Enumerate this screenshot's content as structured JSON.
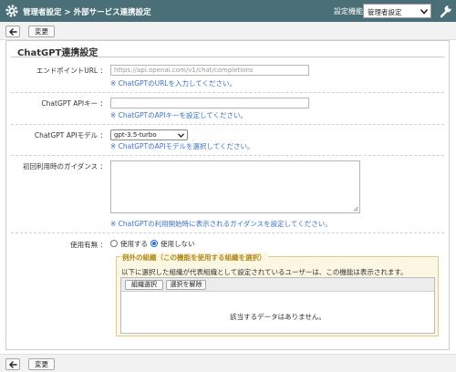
{
  "header": {
    "breadcrumb_root": "管理者設定",
    "breadcrumb_sep": ">",
    "breadcrumb_current": "外部サービス連携設定",
    "function_label": "設定機能：",
    "function_value": "管理者設定",
    "colors": {
      "header_bg": "#4a6f76",
      "header_text": "#ffffff"
    }
  },
  "toolbar": {
    "change_label": "変更"
  },
  "form": {
    "title": "ChatGPT連携設定",
    "endpoint": {
      "label": "エンドポイントURL ：",
      "placeholder": "https://api.openai.com/v1/chat/completions",
      "hint": "※ ChatGPTのURLを入力してください。"
    },
    "apikey": {
      "label": "ChatGPT APIキー ：",
      "value": "",
      "hint": "※ ChatGPTのAPIキーを設定してください。"
    },
    "model": {
      "label": "ChatGPT APIモデル ：",
      "value": "gpt-3.5-turbo",
      "hint": "※ ChatGPTのAPIモデルを選択してください。"
    },
    "guidance": {
      "label": "初回利用時のガイダンス ：",
      "value": "",
      "hint": "※ ChatGPTの利用開始時に表示されるガイダンスを設定してください。"
    },
    "usage": {
      "label": "使用有無 ：",
      "option_use": "使用する",
      "option_nouse": "使用しない",
      "selected": "使用しない"
    },
    "exceptions": {
      "legend": "例外の組織（この機能を使用する組織を選択）",
      "description": "以下に選択した組織が代表組織として設定されているユーザーは、この機能は表示されます。",
      "select_button": "組織選択",
      "clear_button": "選択を解除",
      "empty_message": "該当するデータはありません。"
    }
  },
  "icons": {
    "header_left": "gear-icon",
    "header_right": "wrench-icon",
    "back": "back-arrow-icon",
    "select_arrow": "chevron-down-icon",
    "resize": "resize-grip-icon"
  }
}
